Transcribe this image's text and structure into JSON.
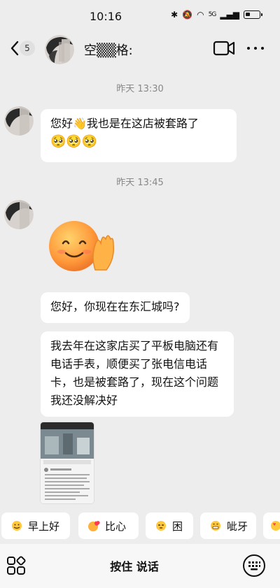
{
  "status": {
    "time": "10:16",
    "network": "5G"
  },
  "header": {
    "back_badge": "5",
    "contact_name": "空▒▒格:"
  },
  "times": [
    "昨天 13:30",
    "昨天 13:45"
  ],
  "messages": {
    "msg1": "您好👋我也是在这店被套路了",
    "msg1_emojis": "🥺🥺🥺",
    "msg3": "您好，你现在在东汇城吗?",
    "msg4": "我去年在这家店买了平板电脑还有电话手表，顺便买了张电信电话卡，也是被套路了，现在这个问题我还没解决好"
  },
  "quick_replies": [
    {
      "label": "早上好",
      "icon": "sun-face-icon"
    },
    {
      "label": "比心",
      "icon": "heart-hands-icon"
    },
    {
      "label": "困",
      "icon": "sleepy-face-icon"
    },
    {
      "label": "呲牙",
      "icon": "grin-face-icon"
    }
  ],
  "input": {
    "hold_to_talk": "按住 说话"
  },
  "colors": {
    "background": "#ededed",
    "bubble": "#ffffff",
    "text": "#111111",
    "time": "#888888"
  }
}
